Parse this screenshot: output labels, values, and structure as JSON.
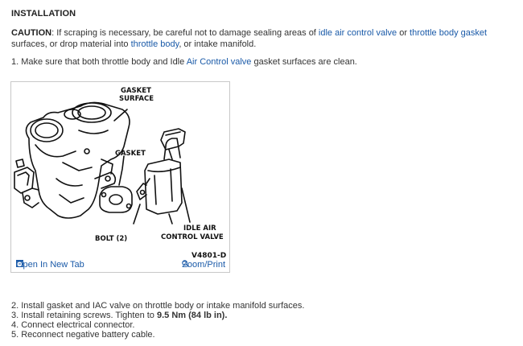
{
  "heading": "INSTALLATION",
  "caution": {
    "label": "CAUTION",
    "t1": ": If scraping is necessary, be careful not to damage sealing areas of ",
    "link1": "idle air control valve",
    "t2": " or ",
    "link2": "throttle body gasket",
    "t3": " surfaces, or drop material into ",
    "link3": "throttle body",
    "t4": ", or intake manifold."
  },
  "step1": {
    "prefix": "1. Make sure that both throttle body and Idle ",
    "link": "Air Control valve",
    "suffix": " gasket surfaces are clean."
  },
  "figure": {
    "label_gasket_surface_1": "GASKET",
    "label_gasket_surface_2": "SURFACE",
    "label_gasket": "GASKET",
    "label_bolt": "BOLT (2)",
    "label_iacv_1": "IDLE AIR",
    "label_iacv_2": "CONTROL VALVE",
    "figure_code": "V4801-D",
    "open_tab": "Open In New Tab",
    "zoom_print": "Zoom/Print"
  },
  "steps": [
    {
      "text": "2. Install gasket and IAC valve on throttle body or intake manifold surfaces."
    },
    {
      "prefix": "3. Install retaining screws. Tighten to ",
      "bold": "9.5 Nm (84 lb in).",
      "suffix": ""
    },
    {
      "text": "4. Connect electrical connector."
    },
    {
      "text": "5. Reconnect negative battery cable."
    }
  ],
  "colors": {
    "link": "#1a5aa8",
    "text": "#333333",
    "border": "#c8c8c8"
  }
}
